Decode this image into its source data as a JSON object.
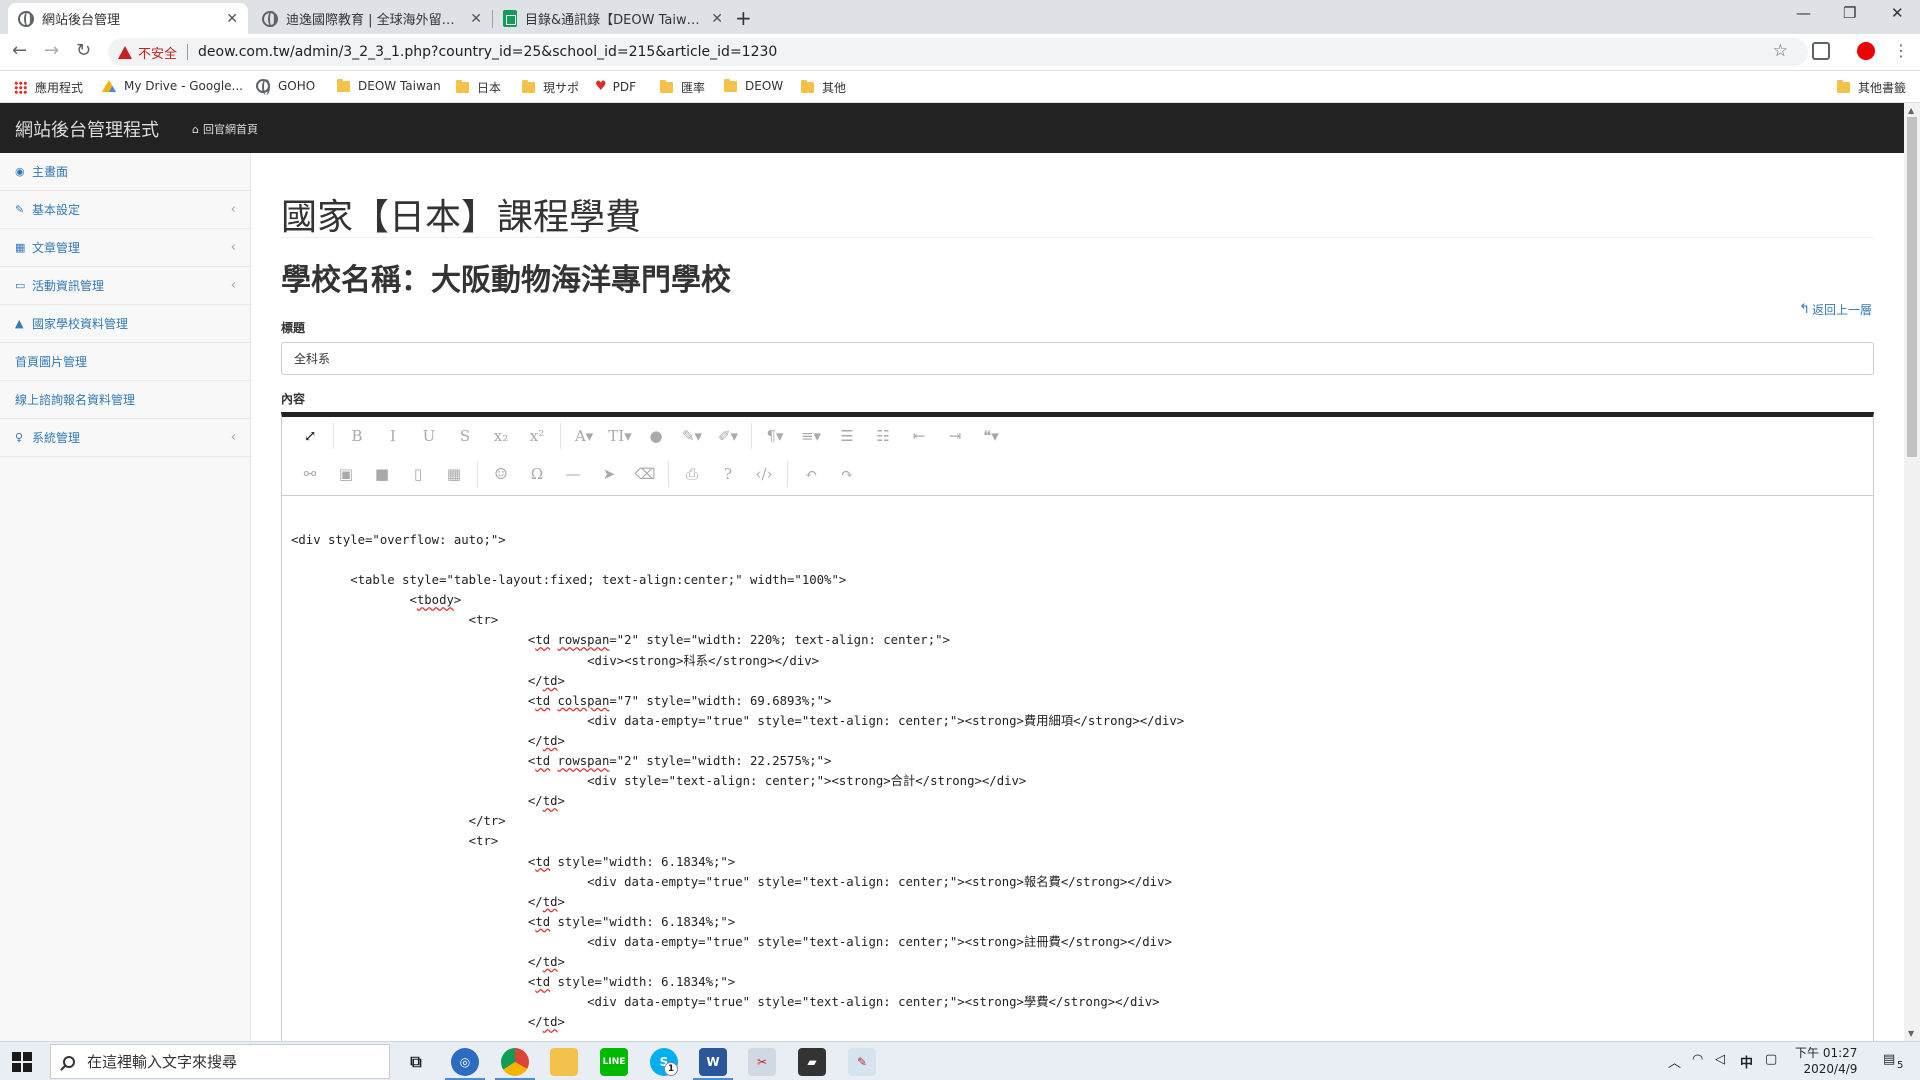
{
  "browser": {
    "tabs": [
      {
        "title": "網站後台管理",
        "active": true
      },
      {
        "title": "迪逸國際教育 | 全球海外留學領航",
        "active": false
      },
      {
        "title": "目錄&通訊錄【DEOW Taiwan】",
        "active": false
      }
    ],
    "security_label": "不安全",
    "url": "deow.com.tw/admin/3_2_3_1.php?country_id=25&school_id=215&article_id=1230",
    "bookmarks": [
      "應用程式",
      "My Drive - Google...",
      "GOHO",
      "DEOW Taiwan",
      "日本",
      "現サポ",
      "PDF",
      "匯率",
      "DEOW",
      "其他"
    ],
    "other_bookmarks": "其他書籤"
  },
  "app": {
    "brand": "網站後台管理程式",
    "home_link": "回官網首頁",
    "sidebar": [
      {
        "label": "主畫面",
        "icon": "dashboard-icon",
        "glyph": "◉",
        "has_submenu": false
      },
      {
        "label": "基本設定",
        "icon": "wrench-icon",
        "glyph": "✎",
        "has_submenu": true
      },
      {
        "label": "文章管理",
        "icon": "calendar-icon",
        "glyph": "▦",
        "has_submenu": true
      },
      {
        "label": "活動資訊管理",
        "icon": "keyboard-icon",
        "glyph": "▭",
        "has_submenu": true
      },
      {
        "label": "國家學校資料管理",
        "icon": "graduation-cap-icon",
        "glyph": "▲",
        "has_submenu": false
      },
      {
        "label": "首頁圖片管理",
        "icon": "",
        "glyph": "",
        "has_submenu": false
      },
      {
        "label": "線上諮詢報名資料管理",
        "icon": "",
        "glyph": "",
        "has_submenu": false
      },
      {
        "label": "系統管理",
        "icon": "lightbulb-icon",
        "glyph": "♀",
        "has_submenu": true
      }
    ],
    "page_title": "國家【日本】課程學費",
    "sub_title": "學校名稱：大阪動物海洋專門學校",
    "back_link": "返回上一層",
    "title_label": "標題",
    "title_value": "全科系",
    "content_label": "內容"
  },
  "editor": {
    "toolbar_row1": [
      {
        "name": "fullscreen-icon",
        "glyph": "⤢",
        "dark": true
      },
      {
        "sep": true
      },
      {
        "name": "bold-icon",
        "glyph": "B"
      },
      {
        "name": "italic-icon",
        "glyph": "I"
      },
      {
        "name": "underline-icon",
        "glyph": "U"
      },
      {
        "name": "strikethrough-icon",
        "glyph": "S"
      },
      {
        "name": "subscript-icon",
        "glyph": "x₂"
      },
      {
        "name": "superscript-icon",
        "glyph": "x²"
      },
      {
        "sep": true
      },
      {
        "name": "font-family-icon",
        "glyph": "A▾"
      },
      {
        "name": "font-size-icon",
        "glyph": "TI▾"
      },
      {
        "name": "text-color-icon",
        "glyph": "●"
      },
      {
        "name": "inline-style-icon",
        "glyph": "✎▾"
      },
      {
        "name": "paragraph-style-icon",
        "glyph": "✐▾"
      },
      {
        "sep": true
      },
      {
        "name": "paragraph-format-icon",
        "glyph": "¶▾"
      },
      {
        "name": "align-icon",
        "glyph": "≡▾"
      },
      {
        "name": "ordered-list-icon",
        "glyph": "☰"
      },
      {
        "name": "unordered-list-icon",
        "glyph": "☷"
      },
      {
        "name": "outdent-icon",
        "glyph": "⇤"
      },
      {
        "name": "indent-icon",
        "glyph": "⇥"
      },
      {
        "name": "quote-icon",
        "glyph": "❝▾"
      }
    ],
    "toolbar_row2": [
      {
        "name": "link-icon",
        "glyph": "⚯"
      },
      {
        "name": "image-icon",
        "glyph": "▣"
      },
      {
        "name": "video-icon",
        "glyph": "■"
      },
      {
        "name": "file-icon",
        "glyph": "▯"
      },
      {
        "name": "table-icon",
        "glyph": "▦"
      },
      {
        "sep": true
      },
      {
        "name": "emoticon-icon",
        "glyph": "☺"
      },
      {
        "name": "special-char-icon",
        "glyph": "Ω"
      },
      {
        "name": "horizontal-line-icon",
        "glyph": "—"
      },
      {
        "name": "select-all-icon",
        "glyph": "➤"
      },
      {
        "name": "clear-format-icon",
        "glyph": "⌫"
      },
      {
        "sep": true
      },
      {
        "name": "print-icon",
        "glyph": "⎙"
      },
      {
        "name": "help-icon",
        "glyph": "?"
      },
      {
        "name": "code-view-icon",
        "glyph": "‹/›"
      },
      {
        "sep": true
      },
      {
        "name": "undo-icon",
        "glyph": "↶"
      },
      {
        "name": "redo-icon",
        "glyph": "↷"
      }
    ],
    "code_lines": [
      "<div style=\"overflow: auto;\">",
      "",
      "        <table style=\"table-layout:fixed; text-align:center;\" width=\"100%\">",
      "                <tbody>",
      "                        <tr>",
      "                                <td rowspan=\"2\" style=\"width: 220%; text-align: center;\">",
      "                                        <div><strong>科系</strong></div>",
      "                                </td>",
      "                                <td colspan=\"7\" style=\"width: 69.6893%;\">",
      "                                        <div data-empty=\"true\" style=\"text-align: center;\"><strong>費用細項</strong></div>",
      "                                </td>",
      "                                <td rowspan=\"2\" style=\"width: 22.2575%;\">",
      "                                        <div style=\"text-align: center;\"><strong>合計</strong></div>",
      "                                </td>",
      "                        </tr>",
      "                        <tr>",
      "                                <td style=\"width: 6.1834%;\">",
      "                                        <div data-empty=\"true\" style=\"text-align: center;\"><strong>報名費</strong></div>",
      "                                </td>",
      "                                <td style=\"width: 6.1834%;\">",
      "                                        <div data-empty=\"true\" style=\"text-align: center;\"><strong>註冊費</strong></div>",
      "                                </td>",
      "                                <td style=\"width: 6.1834%;\">",
      "                                        <div data-empty=\"true\" style=\"text-align: center;\"><strong>學費</strong></div>",
      "                                </td>"
    ]
  },
  "taskbar": {
    "search_placeholder": "在這裡輸入文字來搜尋",
    "ime": "中",
    "clock_time": "下午 01:27",
    "clock_date": "2020/4/9",
    "notification_count": "5",
    "skype_badge": "1"
  },
  "colors": {
    "navbar_bg": "#222222",
    "link": "#337ab7",
    "warning": "#c5221f"
  }
}
